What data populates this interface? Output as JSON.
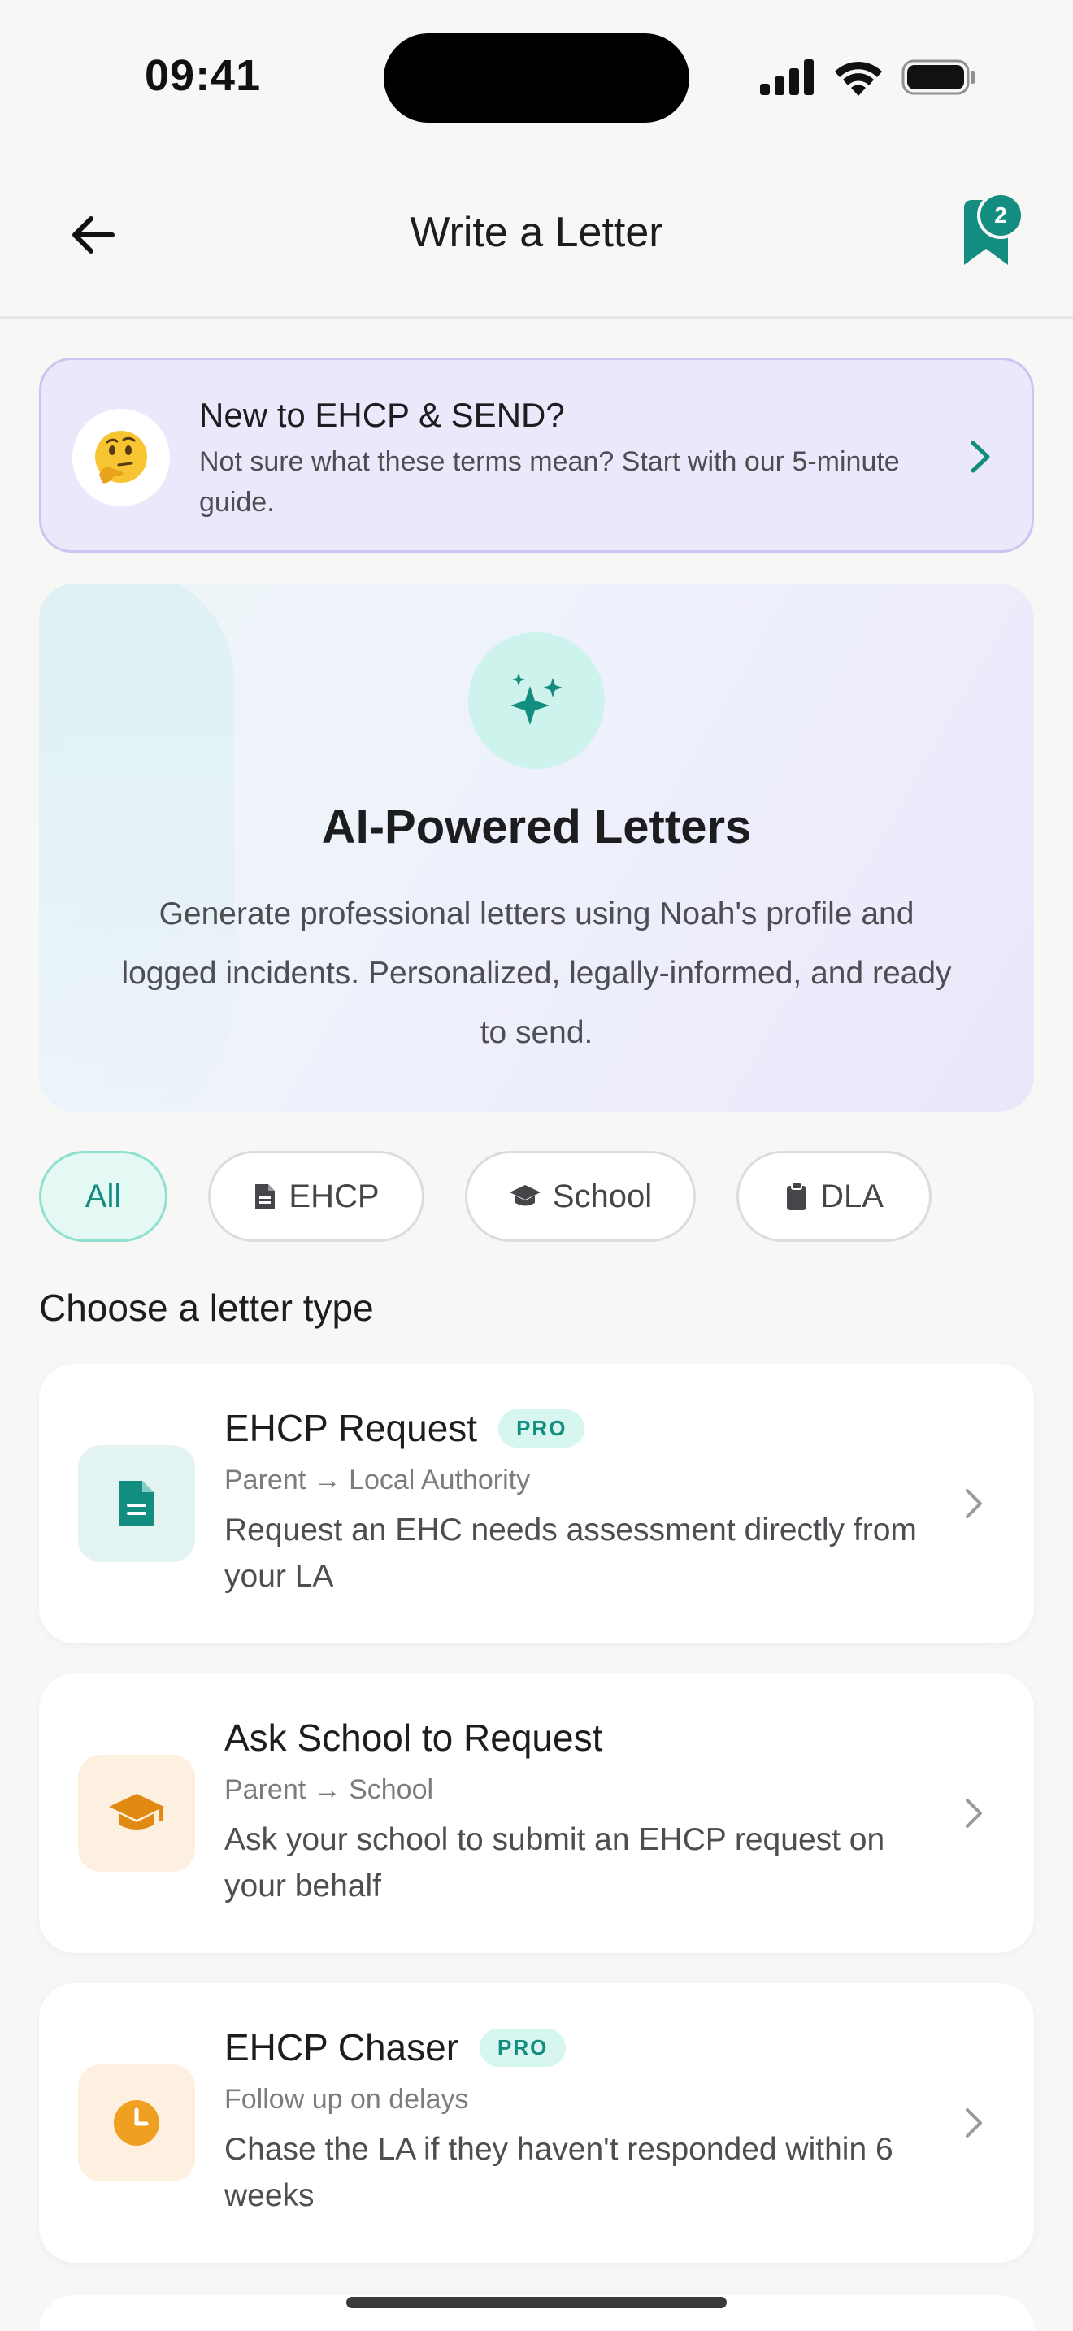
{
  "status_bar": {
    "time": "09:41"
  },
  "nav": {
    "title": "Write a Letter",
    "bookmark_count": "2"
  },
  "guide": {
    "emoji": "🤔",
    "title": "New to EHCP & SEND?",
    "subtitle": "Not sure what these terms mean? Start with our 5-minute guide."
  },
  "hero": {
    "title": "AI-Powered Letters",
    "description": "Generate professional letters using Noah's profile and logged incidents. Personalized, legally-informed, and ready to send."
  },
  "filters": [
    {
      "label": "All",
      "icon": "none",
      "active": true
    },
    {
      "label": "EHCP",
      "icon": "document-icon",
      "active": false
    },
    {
      "label": "School",
      "icon": "graduation-cap-icon",
      "active": false
    },
    {
      "label": "DLA",
      "icon": "clipboard-icon",
      "active": false
    }
  ],
  "section_title": "Choose a letter type",
  "letters": [
    {
      "title": "EHCP Request",
      "badge": "PRO",
      "route": "Parent → Local Authority",
      "description": "Request an EHC needs assessment directly from your LA",
      "icon": "document-icon",
      "icon_bg": "#e2f3f1",
      "icon_color": "#128d7f"
    },
    {
      "title": "Ask School to Request",
      "badge": "",
      "route": "Parent → School",
      "description": "Ask your school to submit an EHCP request on your behalf",
      "icon": "graduation-cap-icon",
      "icon_bg": "#fdf0e0",
      "icon_color": "#e08a12"
    },
    {
      "title": "EHCP Chaser",
      "badge": "PRO",
      "route": "Follow up on delays",
      "description": "Chase the LA if they haven't responded within 6 weeks",
      "icon": "clock-icon",
      "icon_bg": "#fdf0e0",
      "icon_color": "#f0a021"
    }
  ],
  "colors": {
    "accent": "#128d7f",
    "guide_bg": "#ebe8fc",
    "page_bg": "#f7f7f6"
  }
}
